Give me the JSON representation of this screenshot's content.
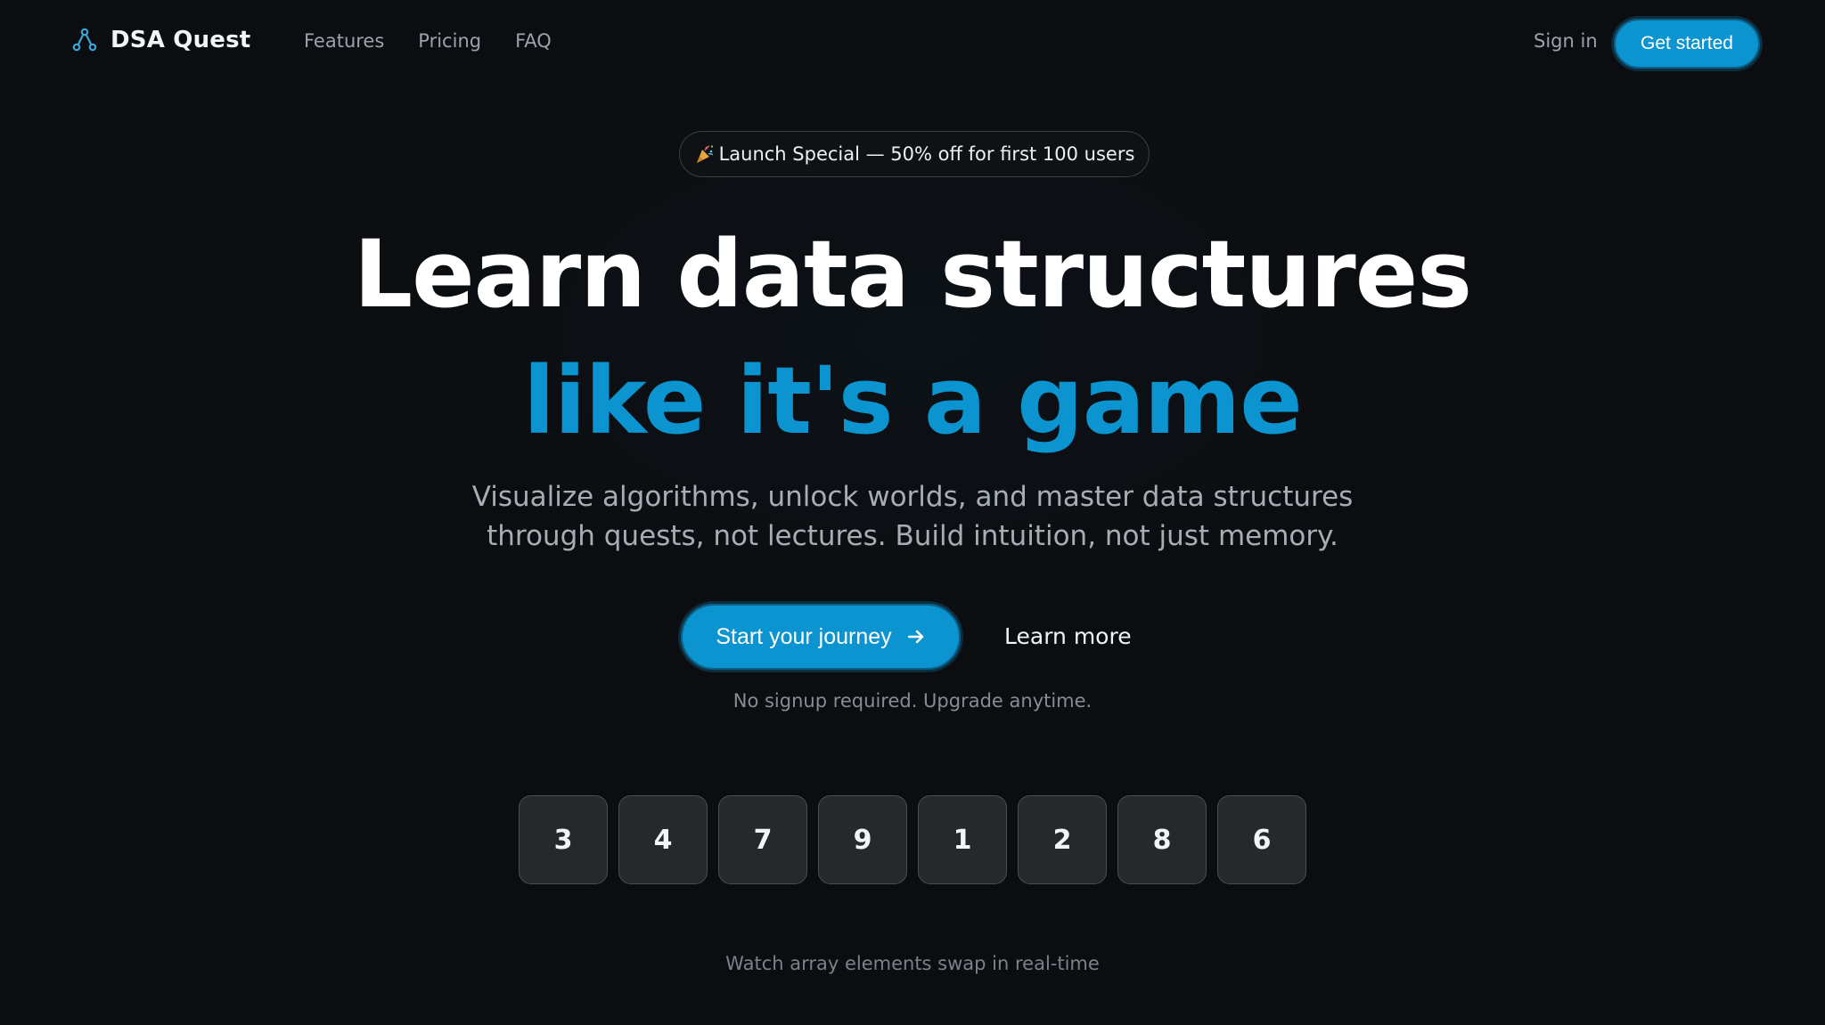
{
  "brand": {
    "name": "DSA Quest",
    "icon": "tree-nodes-icon"
  },
  "nav": {
    "links": [
      "Features",
      "Pricing",
      "FAQ"
    ],
    "sign_in": "Sign in",
    "get_started": "Get started"
  },
  "badge": {
    "emoji": "party-popper-icon",
    "text": "Launch Special — 50% off for first 100 users"
  },
  "hero": {
    "line1": "Learn data structures",
    "line2": "like it's a game",
    "subtitle_line1": "Visualize algorithms, unlock worlds, and master data structures",
    "subtitle_line2": "through quests, not lectures. Build intuition, not just memory."
  },
  "cta": {
    "primary": "Start your journey",
    "secondary": "Learn more",
    "note": "No signup required. Upgrade anytime."
  },
  "array": {
    "values": [
      "3",
      "4",
      "7",
      "9",
      "1",
      "2",
      "8",
      "6"
    ],
    "caption": "Watch array elements swap in real-time"
  },
  "colors": {
    "background": "#0b0d10",
    "accent": "#0b94cf",
    "cell": "#26282c"
  }
}
